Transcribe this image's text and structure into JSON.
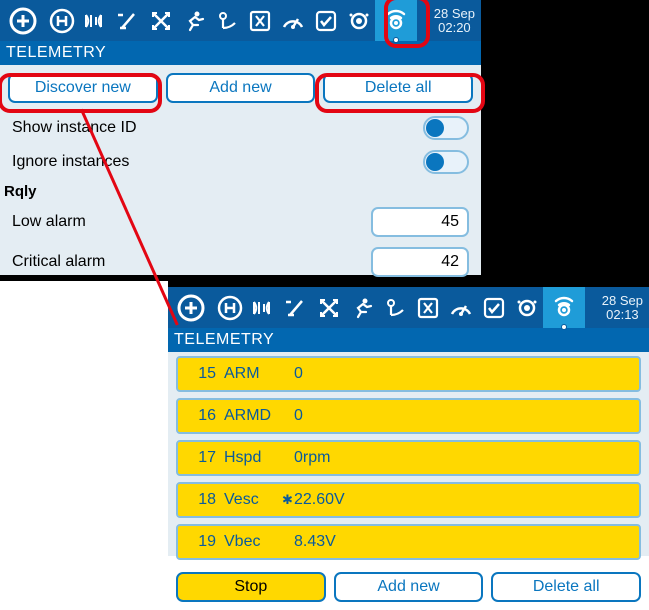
{
  "colors": {
    "accent": "#0a76bf",
    "header": "#0a5a9c",
    "highlight": "#1f9cd8",
    "yellow": "#ffd800",
    "annotation": "#e30613"
  },
  "screen1": {
    "datetime": {
      "date": "28 Sep",
      "time": "02:20"
    },
    "section": "TELEMETRY",
    "buttons": {
      "discover": "Discover new",
      "add": "Add new",
      "delete": "Delete all"
    },
    "rows": {
      "show_instance": "Show instance ID",
      "ignore_instances": "Ignore instances"
    },
    "group": "Rqly",
    "low_alarm": {
      "label": "Low alarm",
      "value": "45"
    },
    "critical_alarm": {
      "label": "Critical alarm",
      "value": "42"
    }
  },
  "screen2": {
    "datetime": {
      "date": "28 Sep",
      "time": "02:13"
    },
    "section": "TELEMETRY",
    "sensors": [
      {
        "idx": "15",
        "name": "ARM",
        "fresh": "",
        "value": "0"
      },
      {
        "idx": "16",
        "name": "ARMD",
        "fresh": "",
        "value": "0"
      },
      {
        "idx": "17",
        "name": "Hspd",
        "fresh": "",
        "value": "0rpm"
      },
      {
        "idx": "18",
        "name": "Vesc",
        "fresh": "✱",
        "value": "22.60V"
      },
      {
        "idx": "19",
        "name": "Vbec",
        "fresh": "",
        "value": "8.43V"
      }
    ],
    "buttons": {
      "stop": "Stop",
      "add": "Add new",
      "delete": "Delete all"
    }
  },
  "icons": [
    "plus-circle-icon",
    "heliport-icon",
    "signal-icon",
    "switch-icon",
    "cross-arrows-icon",
    "runner-icon",
    "transmitter-icon",
    "x-box-icon",
    "gauge-icon",
    "check-box-icon",
    "eye-icon",
    "telemetry-icon"
  ]
}
